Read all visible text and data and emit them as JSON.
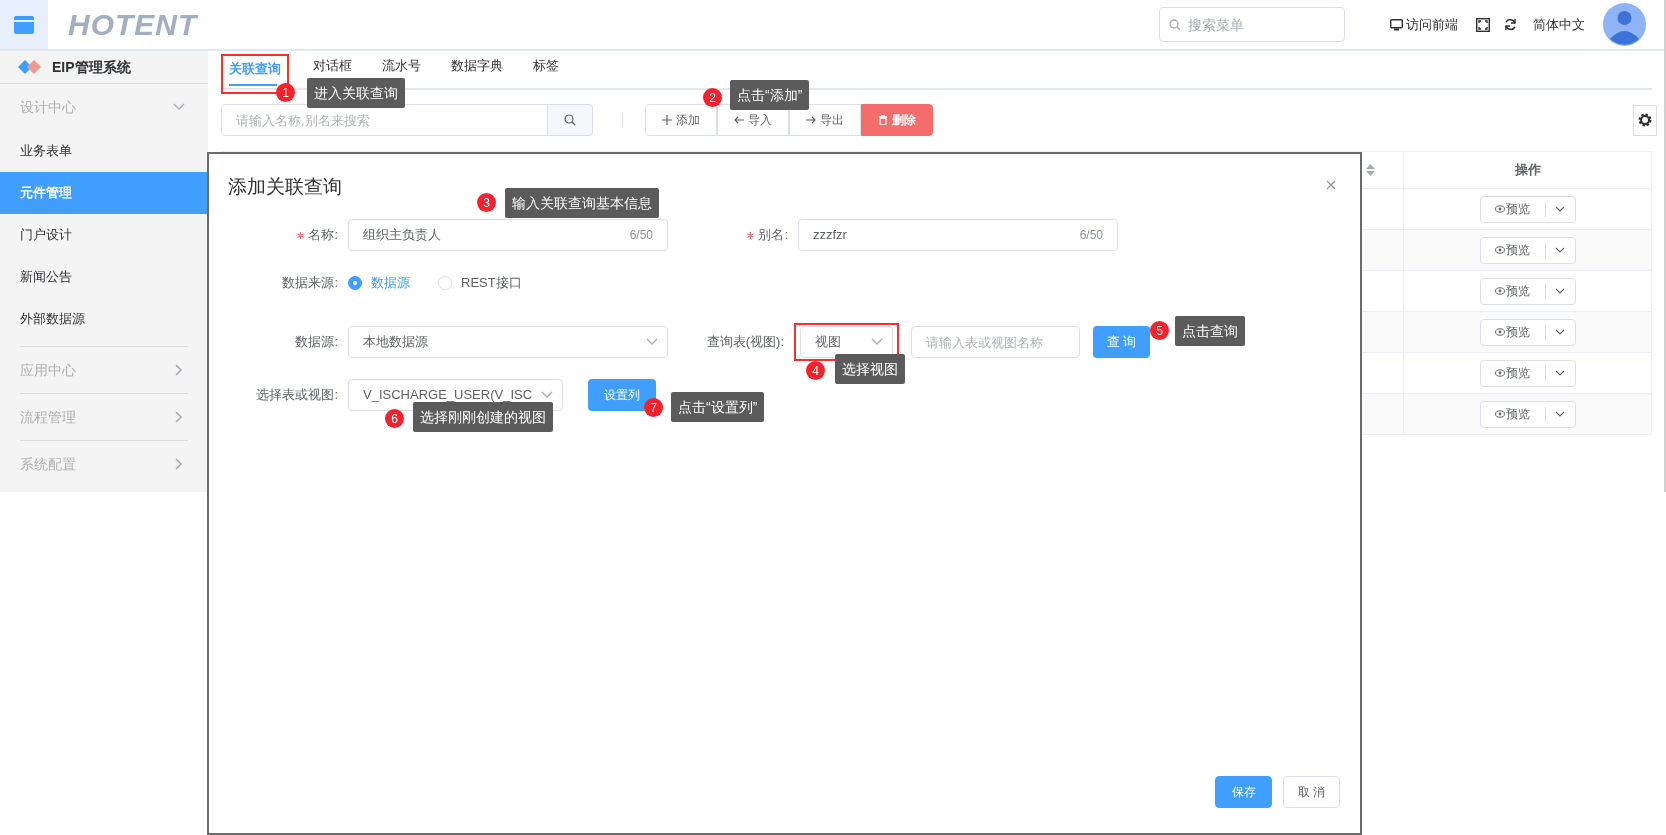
{
  "header": {
    "logo": "HOTENT",
    "search_placeholder": "搜索菜单",
    "links": [
      {
        "kind": "monitor",
        "label": "访问前端"
      },
      {
        "kind": "fullscreen"
      },
      {
        "kind": "refresh"
      },
      {
        "kind": "text",
        "label": "简体中文"
      }
    ]
  },
  "sidebar": {
    "title": "EIP管理系统",
    "groups": [
      {
        "label": "设计中心",
        "expanded": true,
        "children": [
          {
            "label": "业务表单",
            "selected": false
          },
          {
            "label": "元件管理",
            "selected": true
          },
          {
            "label": "门户设计",
            "selected": false
          },
          {
            "label": "新闻公告",
            "selected": false
          },
          {
            "label": "外部数据源",
            "selected": false
          }
        ]
      },
      {
        "label": "应用中心",
        "expanded": false
      },
      {
        "label": "流程管理",
        "expanded": false
      },
      {
        "label": "系统配置",
        "expanded": false
      }
    ]
  },
  "tabs": [
    {
      "label": "关联查询",
      "selected": true,
      "highlighted": true
    },
    {
      "label": "对话框",
      "selected": false,
      "highlighted": false
    },
    {
      "label": "流水号",
      "selected": false,
      "highlighted": false
    },
    {
      "label": "数据字典",
      "selected": false,
      "highlighted": false
    },
    {
      "label": "标签",
      "selected": false,
      "highlighted": false
    }
  ],
  "toolbar": {
    "search_placeholder": "请输入名称,别名来搜索",
    "buttons": [
      {
        "kind": "add",
        "label": "添加"
      },
      {
        "kind": "import",
        "label": "导入"
      },
      {
        "kind": "export",
        "label": "导出"
      },
      {
        "kind": "delete",
        "label": "删除"
      }
    ]
  },
  "table": {
    "columns": [
      {
        "kind": "sort"
      },
      {
        "kind": "text",
        "label": "操作"
      }
    ],
    "rows": [
      {
        "action": "预览"
      },
      {
        "action": "预览"
      },
      {
        "action": "预览"
      },
      {
        "action": "预览"
      },
      {
        "action": "预览"
      },
      {
        "action": "预览"
      }
    ]
  },
  "dialog": {
    "title": "添加关联查询",
    "name": {
      "label": "名称:",
      "required": true,
      "value": "组织主负责人",
      "count": "6/50"
    },
    "alias": {
      "label": "别名:",
      "required": true,
      "value": "zzzfzr",
      "count": "6/50"
    },
    "source_type": {
      "label": "数据来源:",
      "options": [
        {
          "label": "数据源",
          "selected": true
        },
        {
          "label": "REST接口",
          "selected": false
        }
      ]
    },
    "datasource": {
      "label": "数据源:",
      "value": "本地数据源"
    },
    "query_table": {
      "label": "查询表(视图):",
      "value": "视图",
      "highlighted": true,
      "placeholder": "请输入表或视图名称",
      "button": "查 询"
    },
    "table_or_view": {
      "label": "选择表或视图:",
      "value": "V_ISCHARGE_USER(V_ISC",
      "button": "设置列"
    },
    "buttons": [
      {
        "kind": "primary",
        "label": "保存"
      },
      {
        "kind": "default",
        "label": "取 消"
      }
    ]
  },
  "annotations": [
    {
      "number": "1",
      "text": "进入关联查询"
    },
    {
      "number": "2",
      "text": "点击“添加”"
    },
    {
      "number": "3",
      "text": "输入关联查询基本信息"
    },
    {
      "number": "4",
      "text": "选择视图"
    },
    {
      "number": "5",
      "text": "点击查询"
    },
    {
      "number": "6",
      "text": "选择刚刚创建的视图"
    },
    {
      "number": "7",
      "text": "点击“设置列”"
    }
  ]
}
